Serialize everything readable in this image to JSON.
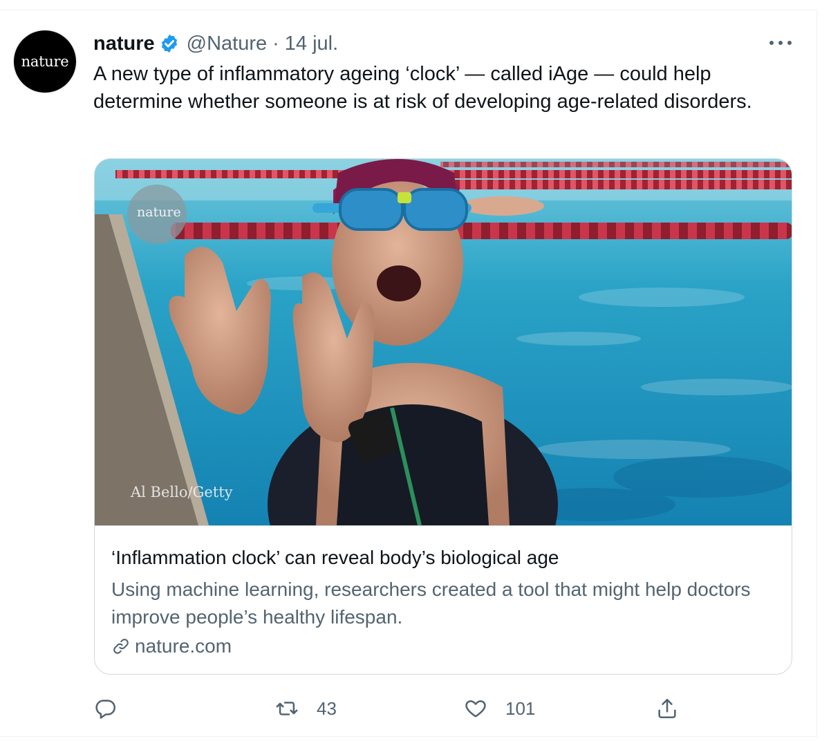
{
  "tweet": {
    "avatar_text": "nature",
    "display_name": "nature",
    "handle": "@Nature",
    "separator": "·",
    "date": "14 jul.",
    "text": "A new type of inflammatory ageing ‘clock’ — called iAge — could help determine whether someone is at risk of developing age-related disorders.",
    "verified_color": "#1d9bf0"
  },
  "card": {
    "image_watermark": "nature",
    "image_credit": "Al Bello/Getty",
    "title": "‘Inflammation clock’ can reveal body’s biological age",
    "description": "Using machine learning, researchers created a tool that might help doctors improve people’s healthy lifespan.",
    "domain": "nature.com"
  },
  "actions": {
    "reply_icon": "reply-icon",
    "retweet_icon": "retweet-icon",
    "retweet_count": "43",
    "like_icon": "heart-icon",
    "like_count": "101",
    "share_icon": "share-icon"
  }
}
